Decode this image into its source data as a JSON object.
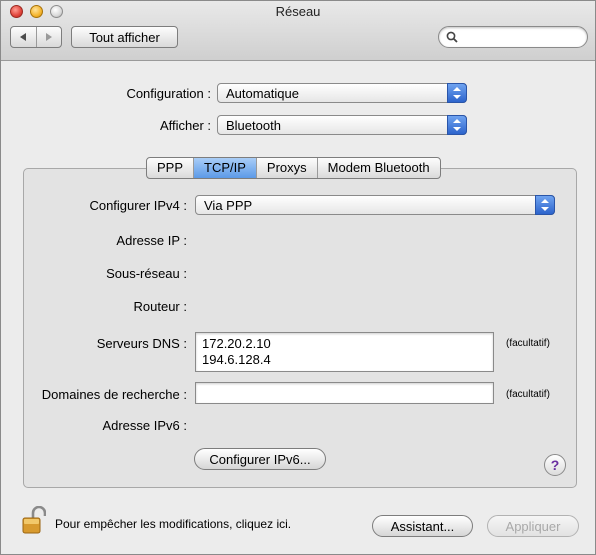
{
  "window": {
    "title": "Réseau"
  },
  "toolbar": {
    "back_icon": "triangle-left",
    "forward_icon": "triangle-right",
    "show_all_label": "Tout afficher",
    "search_value": ""
  },
  "settings": {
    "configuration_label": "Configuration :",
    "configuration_value": "Automatique",
    "show_label": "Afficher :",
    "show_value": "Bluetooth"
  },
  "tabs": [
    {
      "label": "PPP",
      "active": false
    },
    {
      "label": "TCP/IP",
      "active": true
    },
    {
      "label": "Proxys",
      "active": false
    },
    {
      "label": "Modem Bluetooth",
      "active": false
    }
  ],
  "tcpip": {
    "configure_ipv4_label": "Configurer IPv4 :",
    "configure_ipv4_value": "Via PPP",
    "ip_address_label": "Adresse IP :",
    "subnet_label": "Sous-réseau :",
    "router_label": "Routeur :",
    "dns_label": "Serveurs DNS :",
    "dns_values": [
      "172.20.2.10",
      "194.6.128.4"
    ],
    "optional_note": "(facultatif)",
    "search_domains_label": "Domaines de recherche :",
    "search_domains_value": "",
    "ipv6_address_label": "Adresse IPv6 :",
    "configure_ipv6_button": "Configurer IPv6..."
  },
  "footer": {
    "lock_text": "Pour empêcher les modifications, cliquez ici.",
    "assistant_button": "Assistant...",
    "apply_button": "Appliquer"
  },
  "colors": {
    "accent": "#5c9ae8",
    "window_bg": "#ececec",
    "help_glyph": "#6a2ea0"
  }
}
